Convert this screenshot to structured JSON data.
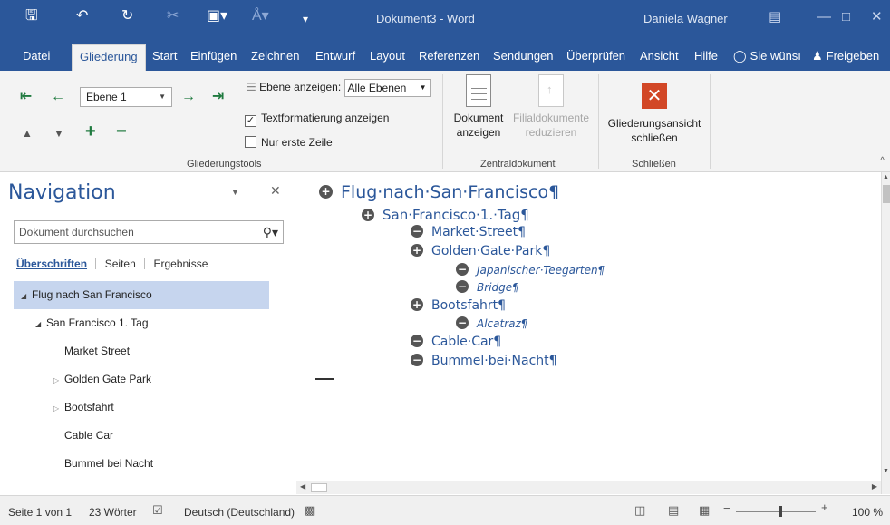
{
  "titlebar": {
    "title": "Dokument3 - Word",
    "user": "Daniela Wagner",
    "quick_access": [
      "save-icon",
      "undo-icon",
      "redo-icon",
      "cut-icon",
      "save-to-device-icon",
      "format-icon",
      "customize-icon"
    ]
  },
  "tabs": {
    "datei": "Datei",
    "gliederung": "Gliederung",
    "start": "Start",
    "einfuegen": "Einfügen",
    "zeichnen": "Zeichnen",
    "entwurf": "Entwurf",
    "layout": "Layout",
    "referenzen": "Referenzen",
    "sendungen": "Sendungen",
    "ueberpruefen": "Überprüfen",
    "ansicht": "Ansicht",
    "hilfe": "Hilfe",
    "tell_me": "Sie wünsı",
    "share": "Freigeben"
  },
  "ribbon": {
    "outline_level": "Ebene 1",
    "show_level_label": "Ebene anzeigen:",
    "show_level_value": "Alle Ebenen",
    "show_text_formatting": "Textformatierung anzeigen",
    "show_text_formatting_checked": true,
    "first_line_only": "Nur erste Zeile",
    "first_line_only_checked": false,
    "group_outline_tools": "Gliederungstools",
    "show_document_line1": "Dokument",
    "show_document_line2": "anzeigen",
    "collapse_subdocs_line1": "Filialdokumente",
    "collapse_subdocs_line2": "reduzieren",
    "group_master_document": "Zentraldokument",
    "close_outline_line1": "Gliederungsansicht",
    "close_outline_line2": "schließen",
    "group_close": "Schließen"
  },
  "navigation": {
    "title": "Navigation",
    "search_placeholder": "Dokument durchsuchen",
    "tabs": [
      "Überschriften",
      "Seiten",
      "Ergebnisse"
    ],
    "items": [
      {
        "label": "Flug nach San Francisco",
        "level": 1,
        "expander": "expanded",
        "selected": true
      },
      {
        "label": "San Francisco 1. Tag",
        "level": 2,
        "expander": "expanded",
        "selected": false
      },
      {
        "label": "Market Street",
        "level": 3,
        "expander": "none",
        "selected": false
      },
      {
        "label": "Golden Gate Park",
        "level": 3,
        "expander": "collapsed",
        "selected": false
      },
      {
        "label": "Bootsfahrt",
        "level": 3,
        "expander": "collapsed",
        "selected": false
      },
      {
        "label": "Cable Car",
        "level": 3,
        "expander": "none",
        "selected": false
      },
      {
        "label": "Bummel bei Nacht",
        "level": 3,
        "expander": "none",
        "selected": false
      }
    ]
  },
  "outline": [
    {
      "text": "Flug·nach·San·Francisco¶",
      "level": 1,
      "symbol": "+"
    },
    {
      "text": "San·Francisco·1.·Tag¶",
      "level": 2,
      "symbol": "+"
    },
    {
      "text": "Market·Street¶",
      "level": 3,
      "symbol": "−"
    },
    {
      "text": "Golden·Gate·Park¶",
      "level": 3,
      "symbol": "+"
    },
    {
      "text": "Japanischer·Teegarten¶",
      "level": 4,
      "symbol": "−"
    },
    {
      "text": "Bridge¶",
      "level": 4,
      "symbol": "−"
    },
    {
      "text": "Bootsfahrt¶",
      "level": 3,
      "symbol": "+"
    },
    {
      "text": "Alcatraz¶",
      "level": 4,
      "symbol": "−"
    },
    {
      "text": "Cable·Car¶",
      "level": 3,
      "symbol": "−"
    },
    {
      "text": "Bummel·bei·Nacht¶",
      "level": 3,
      "symbol": "−"
    }
  ],
  "statusbar": {
    "page": "Seite 1 von 1",
    "words": "23 Wörter",
    "language": "Deutsch (Deutschland)",
    "zoom": "100 %"
  },
  "colors": {
    "brand": "#2b579a",
    "close_button": "#d24726",
    "nav_selected": "#c6d5ee"
  }
}
